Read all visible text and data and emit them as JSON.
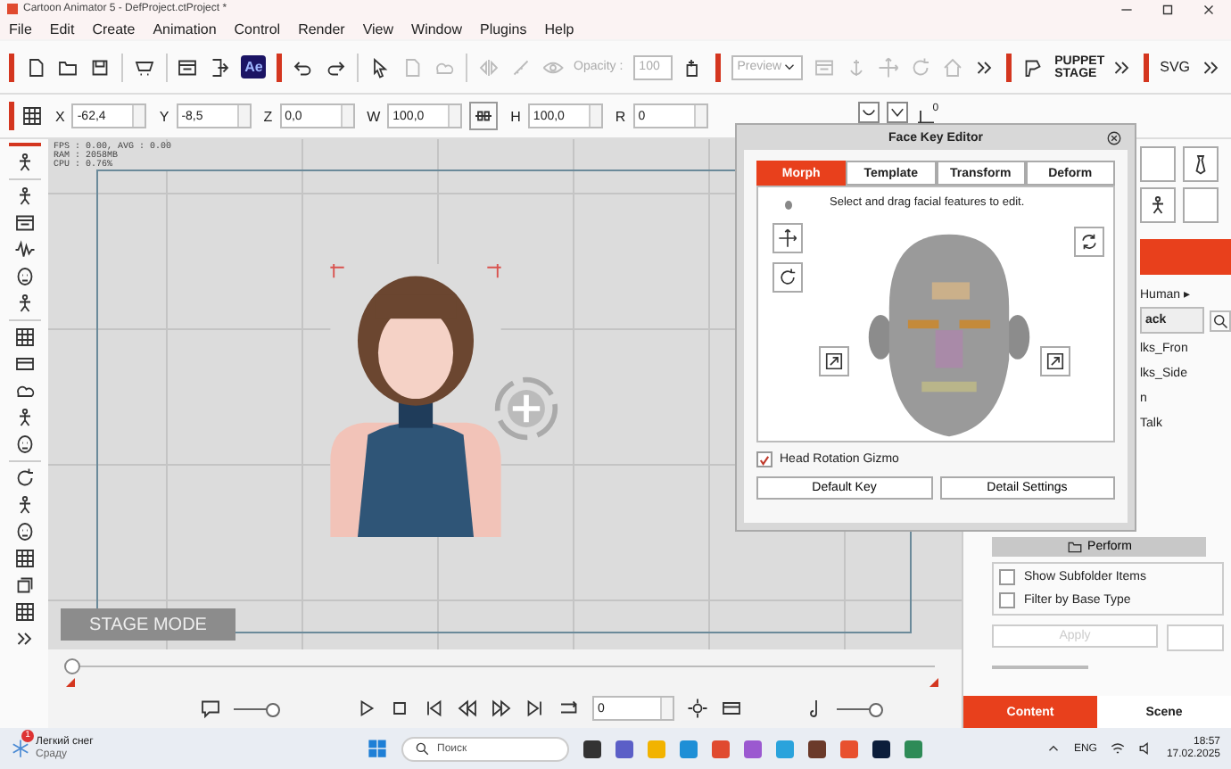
{
  "window": {
    "title": "Cartoon Animator 5 - DefProject.ctProject *"
  },
  "menu": [
    "File",
    "Edit",
    "Create",
    "Animation",
    "Control",
    "Render",
    "View",
    "Window",
    "Plugins",
    "Help"
  ],
  "toolbar": {
    "ae_logo": "Ae",
    "opacity_label": "Opacity :",
    "opacity_value": "100",
    "preview": "Preview",
    "puppet_stage": "PUPPET STAGE",
    "svg": "SVG"
  },
  "transform": [
    {
      "label": "X",
      "value": "-62,4"
    },
    {
      "label": "Y",
      "value": "-8,5"
    },
    {
      "label": "Z",
      "value": "0,0"
    },
    {
      "label": "W",
      "value": "100,0"
    },
    {
      "label": "H",
      "value": "100,0"
    },
    {
      "label": "R",
      "value": "0"
    }
  ],
  "baseline_value": "0",
  "stage": {
    "stats": [
      "FPS : 0.00, AVG : 0.00",
      "RAM : 2058MB",
      "CPU : 0.76%"
    ],
    "mode": "STAGE MODE"
  },
  "timeline": {
    "level": 0
  },
  "playback": {
    "frame": "0",
    "caption_slider": {
      "level": 0.9
    },
    "volume_slider": {
      "level": 0.9
    }
  },
  "face_key_editor": {
    "title": "Face Key Editor",
    "tabs": [
      {
        "label": "Morph",
        "selected": true
      },
      {
        "label": "Template",
        "selected": false
      },
      {
        "label": "Transform",
        "selected": false
      },
      {
        "label": "Deform",
        "selected": false
      }
    ],
    "hint": "Select and drag facial features to edit.",
    "gizmo": {
      "label": "Head Rotation Gizmo",
      "checked": true
    },
    "buttons": [
      "Default Key",
      "Detail Settings"
    ]
  },
  "content_panel": {
    "breadcrumb": "Human ▸",
    "list_header": "ack",
    "items": [
      "lks_Fron",
      "lks_Side",
      "n",
      "Talk"
    ],
    "perform": "Perform",
    "options": [
      {
        "label": "Show Subfolder Items",
        "checked": false
      },
      {
        "label": "Filter by Base Type",
        "checked": false
      }
    ],
    "apply": {
      "label": "Apply",
      "disabled": true
    },
    "tabs": [
      {
        "label": "Content",
        "selected": true
      },
      {
        "label": "Scene",
        "selected": false
      }
    ]
  },
  "taskbar": {
    "weather": {
      "title": "Легкий снег",
      "subtitle": "Сраду",
      "badge": "1"
    },
    "search_placeholder": "Поиск",
    "language": "ENG",
    "time": "18:57",
    "date": "17.02.2025"
  }
}
